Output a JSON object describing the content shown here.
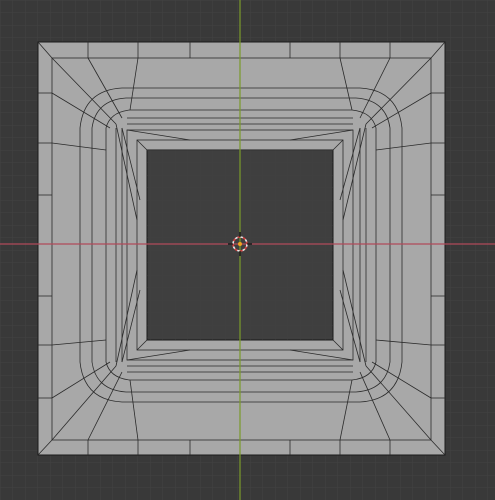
{
  "viewport": {
    "view": "top-orthographic",
    "background_color": "#393939",
    "grid_minor_color": "#434343",
    "grid_major_color": "#4a4a4a",
    "x_axis_color": "#b04a5a",
    "y_axis_color": "#7a9a2a",
    "face_color": "#a8a8a8",
    "edge_color": "#1a1a1a",
    "cursor_icon": "3d-cursor-icon",
    "origin_icon": "object-origin-icon"
  }
}
